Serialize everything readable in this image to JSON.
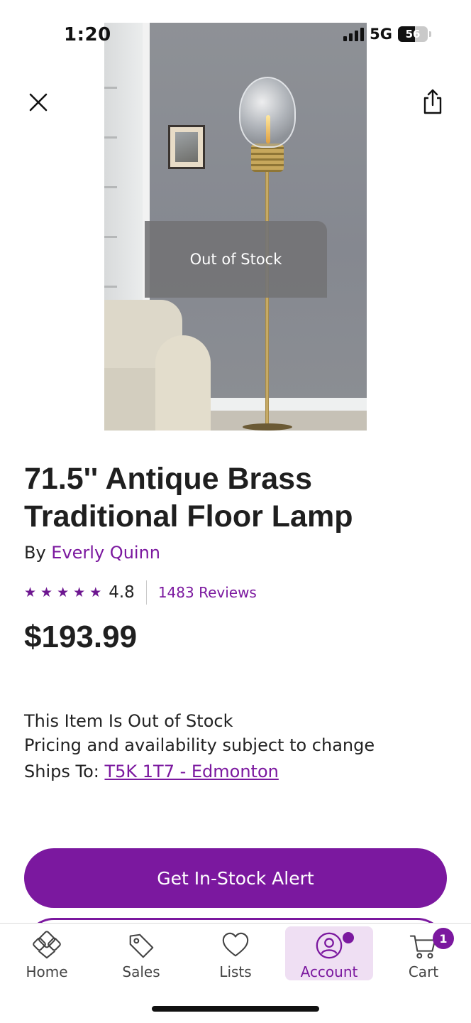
{
  "status_bar": {
    "time": "1:20",
    "network": "5G",
    "battery": "56"
  },
  "product": {
    "image_overlay": "Out of Stock",
    "title": "71.5'' Antique Brass Traditional Floor Lamp",
    "by_prefix": "By ",
    "brand": "Everly Quinn",
    "rating": "4.8",
    "stars": 5,
    "reviews": "1483 Reviews",
    "price": "$193.99"
  },
  "availability": {
    "status": "This Item Is Out of Stock",
    "note": "Pricing and availability subject to change",
    "ships_label": "Ships To: ",
    "ships_location": "T5K 1T7 - Edmonton"
  },
  "actions": {
    "primary": "Get In-Stock Alert"
  },
  "bottom_nav": {
    "items": [
      {
        "label": "Home",
        "icon": "home-icon"
      },
      {
        "label": "Sales",
        "icon": "tag-icon"
      },
      {
        "label": "Lists",
        "icon": "heart-icon"
      },
      {
        "label": "Account",
        "icon": "account-icon"
      },
      {
        "label": "Cart",
        "icon": "cart-icon"
      }
    ],
    "active": "Account",
    "cart_count": "1"
  },
  "colors": {
    "accent": "#7b189f",
    "accent_light": "#efdff3"
  }
}
